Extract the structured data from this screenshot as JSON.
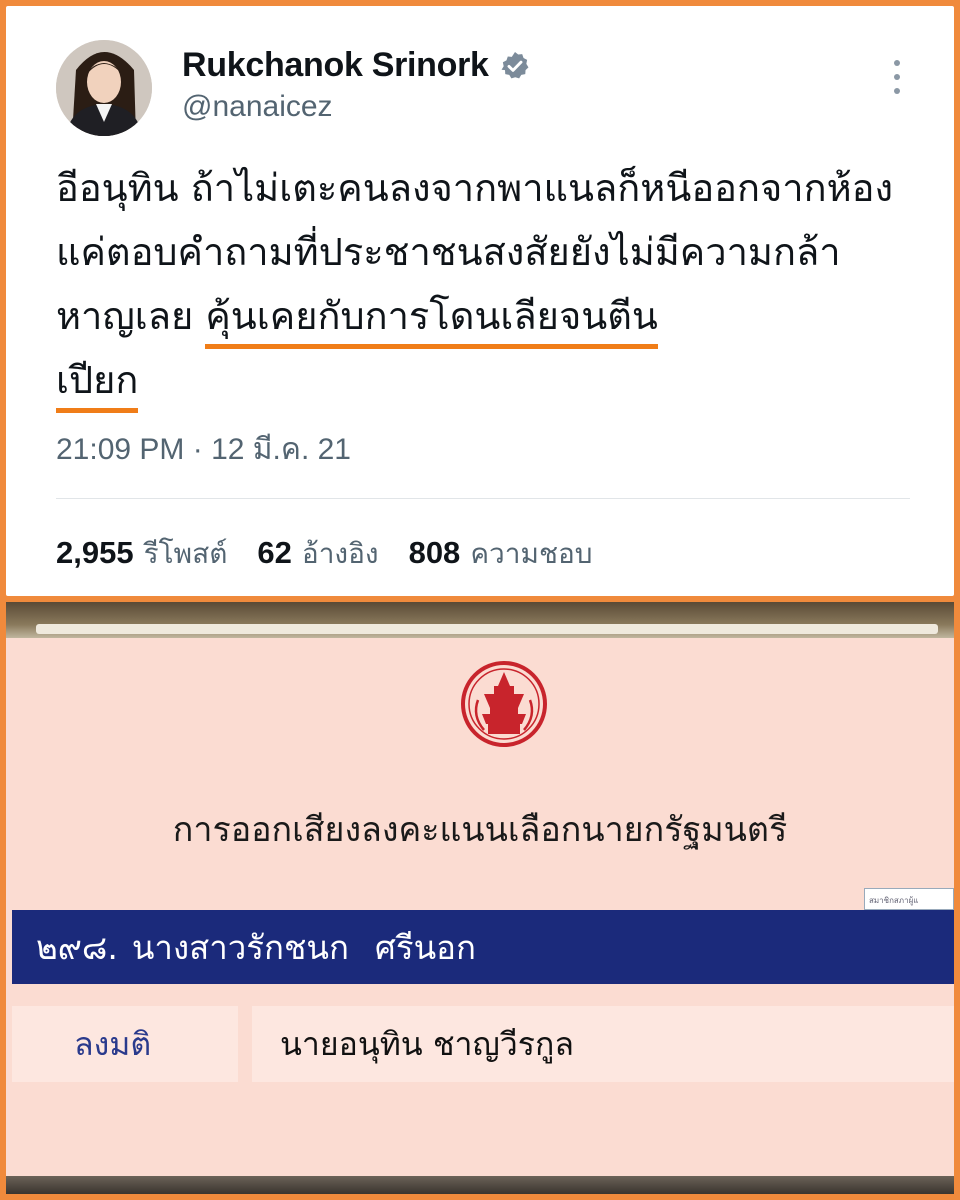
{
  "tweet": {
    "display_name": "Rukchanok Srinork",
    "handle": "@nanaicez",
    "avatar_icon": "profile-photo",
    "verified_icon": "verified-badge-icon",
    "more_icon": "more-vertical-icon",
    "text_part1": "อีอนุทิน ถ้าไม่เตะคนลงจากพาแนลก็หนีออกจากห้อง แค่ตอบคำถามที่ประชาชนสงสัยยังไม่มีความกล้าหาญเลย ",
    "text_highlight_a": "คุ้นเคยกับการโดนเลียจนตีน",
    "text_highlight_b": "เปียก",
    "timestamp": "21:09 PM · 12 มี.ค. 21",
    "stats": [
      {
        "value": "2,955",
        "label": "รีโพสต์"
      },
      {
        "value": "62",
        "label": "อ้างอิง"
      },
      {
        "value": "808",
        "label": "ความชอบ"
      }
    ],
    "underline_color": "#f07d18"
  },
  "vote_screen": {
    "emblem_icon": "parliament-emblem-icon",
    "title": "การออกเสียงลงคะแนนเลือกนายกรัฐมนตรี",
    "corner_text": "สมาชิกสภาผู้แ",
    "member_number": "๒๙๘.",
    "member_prefix": "นางสาวรักชนก",
    "member_surname": "ศรีนอก",
    "vote_label": "ลงมติ",
    "vote_value": "นายอนุทิน ชาญวีรกูล",
    "bar_color": "#1b2a7b"
  }
}
